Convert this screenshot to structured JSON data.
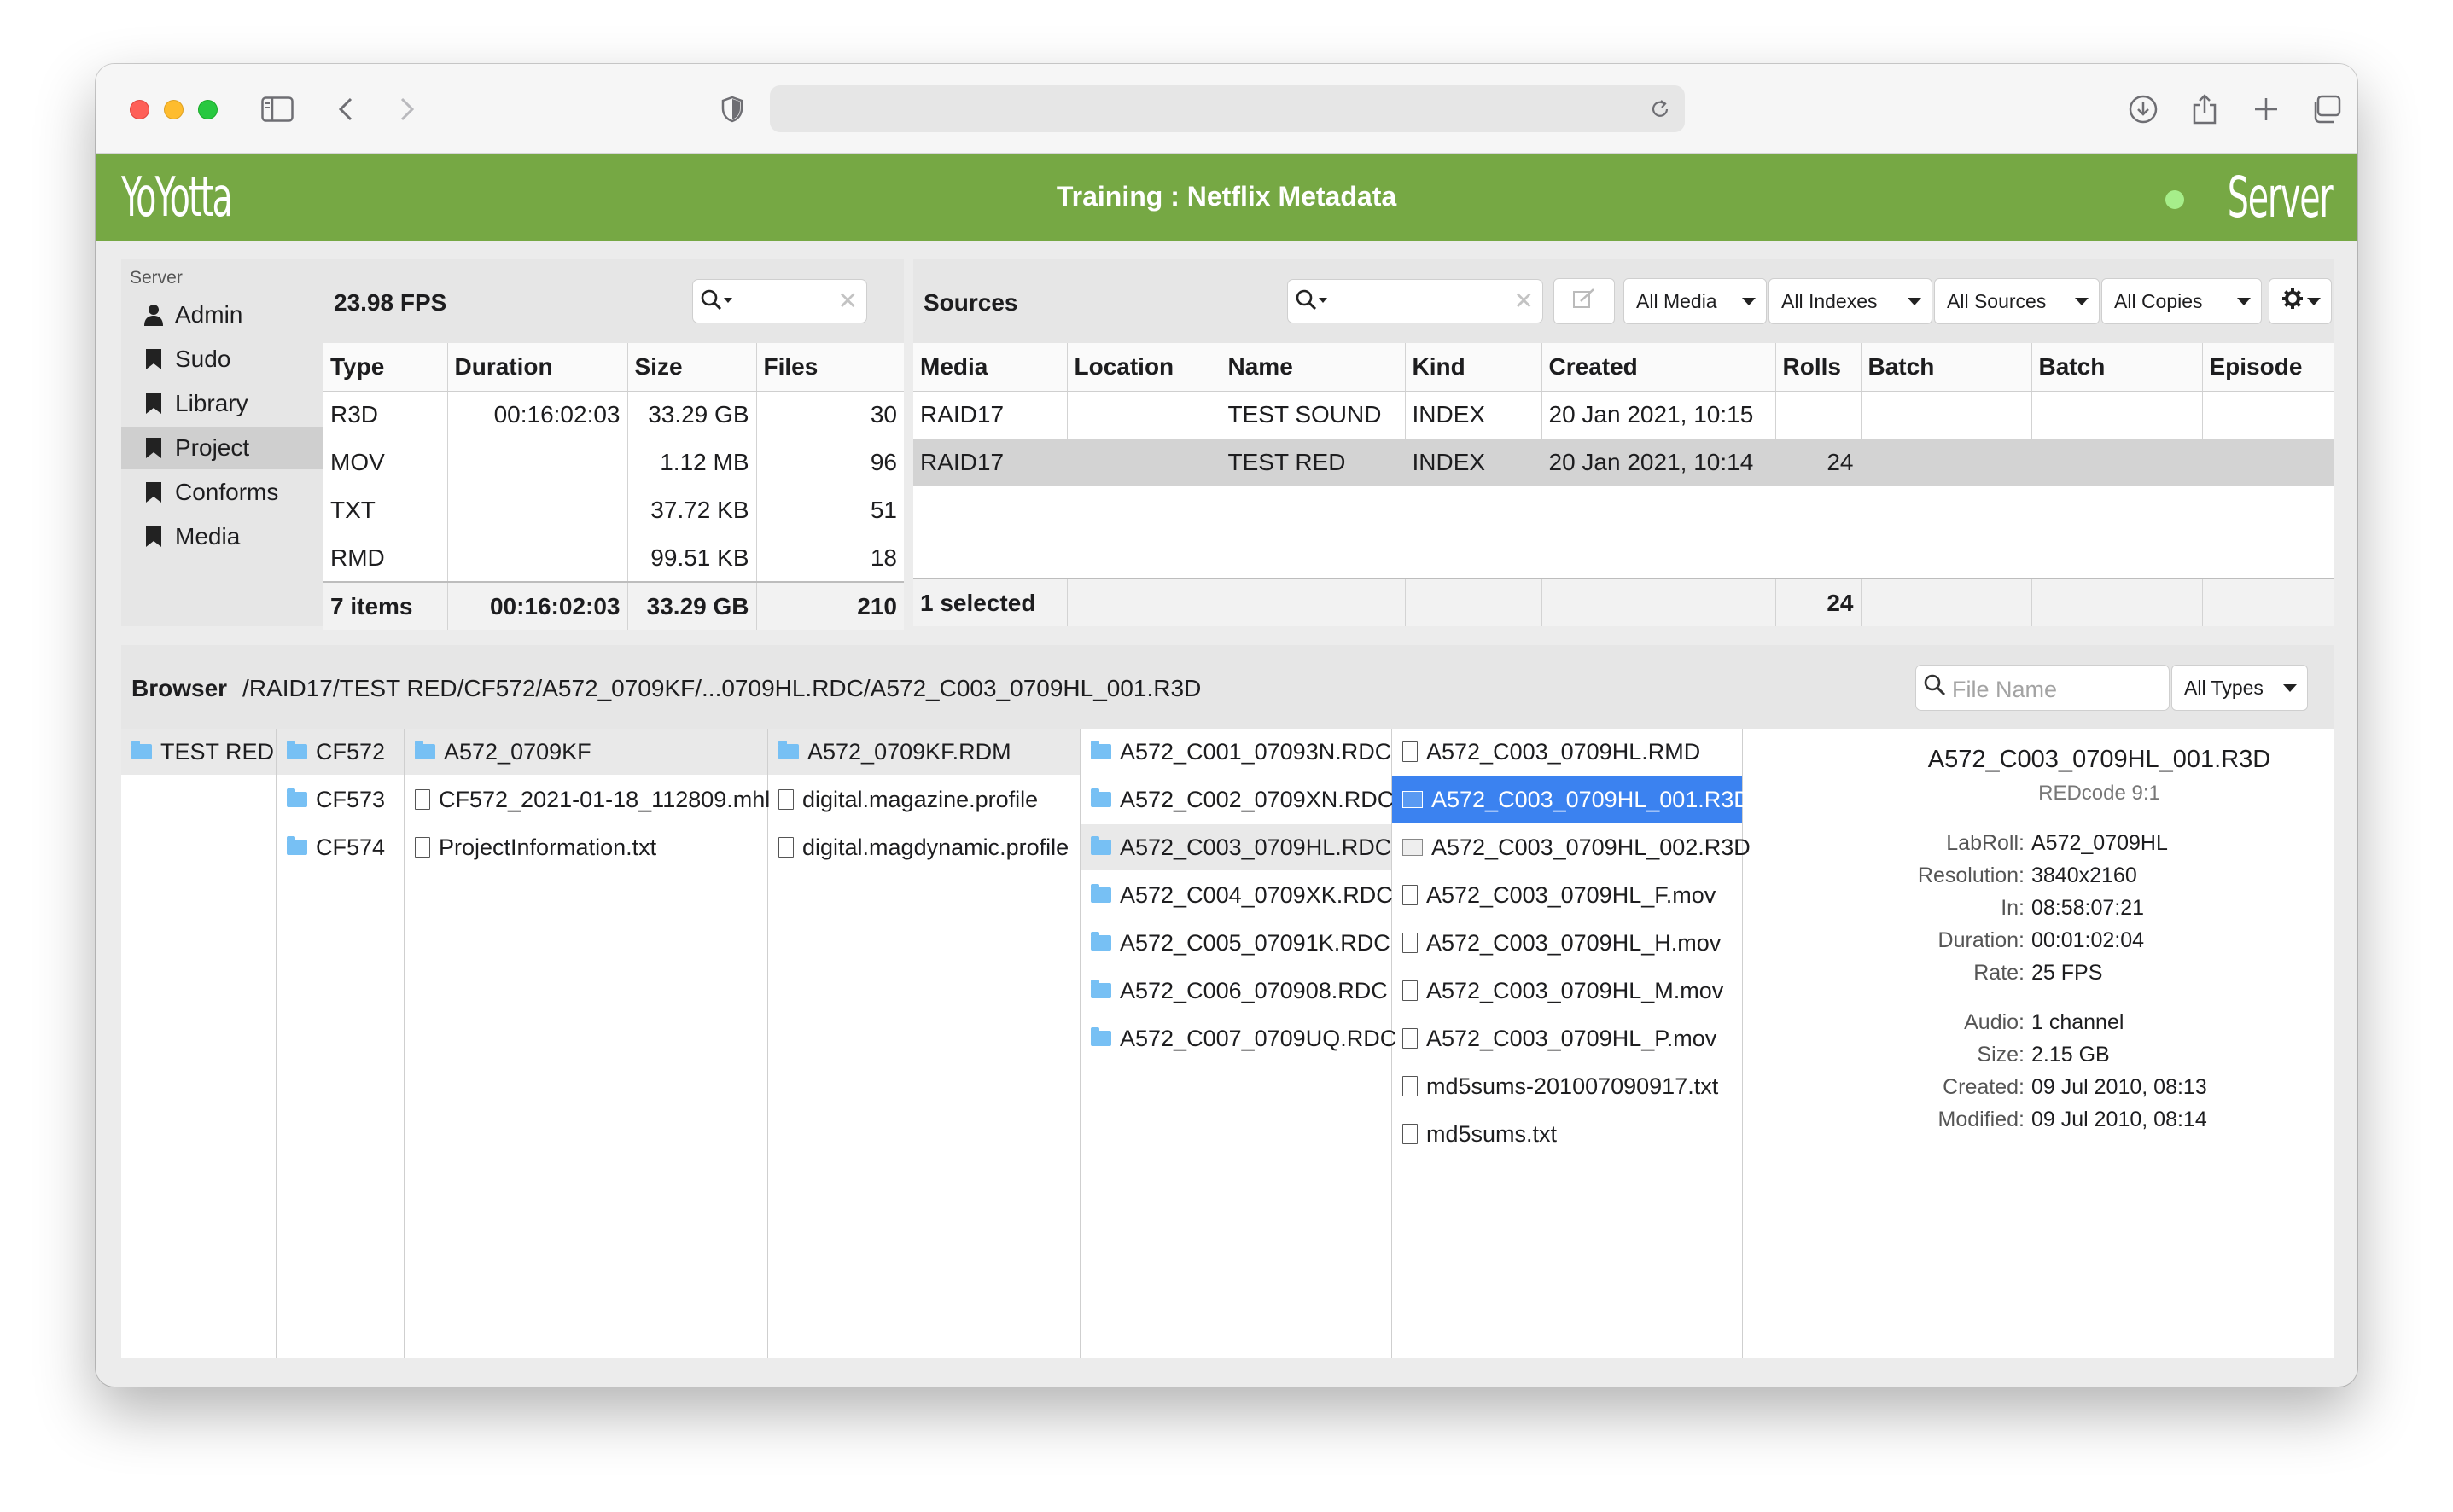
{
  "app": {
    "logo": "YoYotta",
    "title": "Training : Netflix Metadata",
    "server_label": "Server"
  },
  "sidebar": {
    "section": "Server",
    "items": [
      {
        "label": "Admin",
        "icon": "person-icon"
      },
      {
        "label": "Sudo",
        "icon": "bookmark-icon"
      },
      {
        "label": "Library",
        "icon": "bookmark-icon"
      },
      {
        "label": "Project",
        "icon": "bookmark-icon",
        "active": true
      },
      {
        "label": "Conforms",
        "icon": "bookmark-icon"
      },
      {
        "label": "Media",
        "icon": "bookmark-icon"
      }
    ]
  },
  "stats": {
    "fps": "23.98 FPS",
    "columns": [
      "Type",
      "Duration",
      "Size",
      "Files"
    ],
    "rows": [
      [
        "R3D",
        "00:16:02:03",
        "33.29 GB",
        "30"
      ],
      [
        "MOV",
        "",
        "1.12 MB",
        "96"
      ],
      [
        "TXT",
        "",
        "37.72 KB",
        "51"
      ],
      [
        "RMD",
        "",
        "99.51 KB",
        "18"
      ]
    ],
    "footer": [
      "7 items",
      "00:16:02:03",
      "33.29 GB",
      "210"
    ]
  },
  "sources": {
    "title": "Sources",
    "filters": [
      "All Media",
      "All Indexes",
      "All Sources",
      "All Copies"
    ],
    "columns": [
      "Media",
      "Location",
      "Name",
      "Kind",
      "Created",
      "Rolls",
      "Batch",
      "Batch",
      "Episode"
    ],
    "rows": [
      [
        "RAID17",
        "",
        "TEST SOUND",
        "INDEX",
        "20 Jan 2021, 10:15",
        "",
        "",
        "",
        ""
      ],
      [
        "RAID17",
        "",
        "TEST RED",
        "INDEX",
        "20 Jan 2021, 10:14",
        "24",
        "",
        "",
        ""
      ]
    ],
    "footer": [
      "1 selected",
      "",
      "",
      "",
      "",
      "24",
      "",
      "",
      ""
    ]
  },
  "browser": {
    "label": "Browser",
    "path": "/RAID17/TEST RED/CF572/A572_0709KF/...0709HL.RDC/A572_C003_0709HL_001.R3D",
    "search_placeholder": "File Name",
    "type_filter": "All Types",
    "col1": [
      "TEST RED"
    ],
    "col2": [
      "CF572",
      "CF573",
      "CF574"
    ],
    "col3": [
      "A572_0709KF",
      "CF572_2021-01-18_112809.mhl",
      "ProjectInformation.txt"
    ],
    "col4": [
      "A572_0709KF.RDM",
      "digital.magazine.profile",
      "digital.magdynamic.profile"
    ],
    "col5": [
      "A572_C001_07093N.RDC",
      "A572_C002_0709XN.RDC",
      "A572_C003_0709HL.RDC",
      "A572_C004_0709XK.RDC",
      "A572_C005_07091K.RDC",
      "A572_C006_070908.RDC",
      "A572_C007_0709UQ.RDC"
    ],
    "col6": [
      "A572_C003_0709HL.RMD",
      "A572_C003_0709HL_001.R3D",
      "A572_C003_0709HL_002.R3D",
      "A572_C003_0709HL_F.mov",
      "A572_C003_0709HL_H.mov",
      "A572_C003_0709HL_M.mov",
      "A572_C003_0709HL_P.mov",
      "md5sums-201007090917.txt",
      "md5sums.txt"
    ]
  },
  "metadata": {
    "title": "A572_C003_0709HL_001.R3D",
    "subtitle": "REDcode 9:1",
    "fields": [
      {
        "k": "LabRoll:",
        "v": "A572_0709HL"
      },
      {
        "k": "Resolution:",
        "v": "3840x2160"
      },
      {
        "k": "In:",
        "v": "08:58:07:21"
      },
      {
        "k": "Duration:",
        "v": "00:01:02:04"
      },
      {
        "k": "Rate:",
        "v": "25 FPS"
      },
      {
        "k": "Audio:",
        "v": "1 channel"
      },
      {
        "k": "Size:",
        "v": "2.15 GB"
      },
      {
        "k": "Created:",
        "v": "09 Jul 2010, 08:13"
      },
      {
        "k": "Modified:",
        "v": "09 Jul 2010, 08:14"
      }
    ]
  },
  "colors": {
    "brand": "#76a844",
    "selection": "#3b82f0",
    "folder": "#77c0f4",
    "status": "#a6ee8a"
  }
}
